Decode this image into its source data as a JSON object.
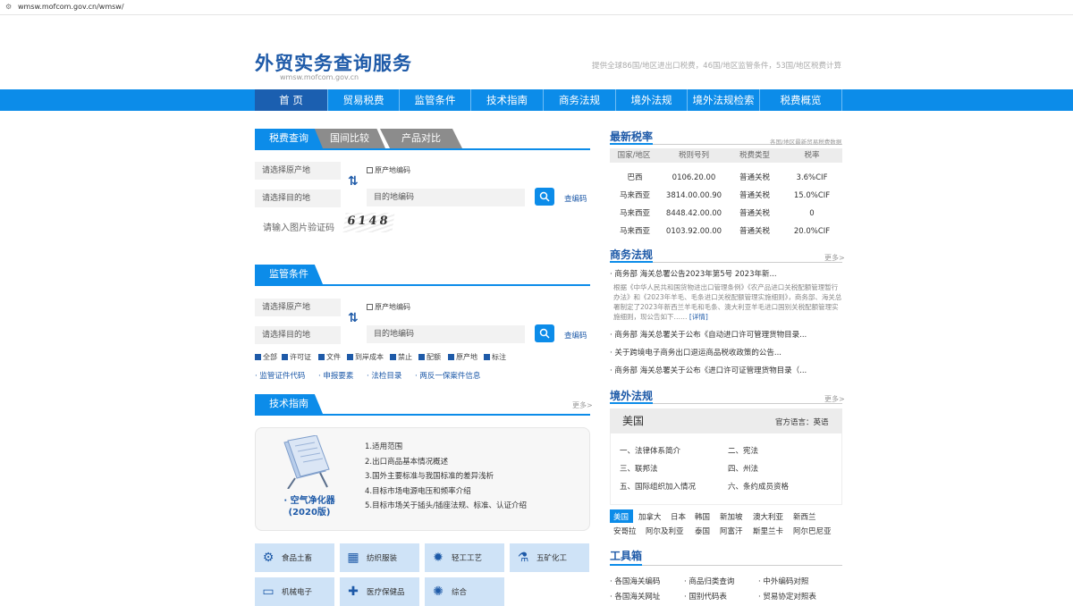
{
  "browser": {
    "url": "wmsw.mofcom.gov.cn/wmsw/"
  },
  "header": {
    "title": "外贸实务查询服务",
    "subtitle": "wmsw.mofcom.gov.cn",
    "slogan": "提供全球86国/地区进出口税费，46国/地区监管条件，53国/地区税费计算"
  },
  "nav": [
    "首 页",
    "贸易税费",
    "监管条件",
    "技术指南",
    "商务法规",
    "境外法规",
    "境外法规检索",
    "税费概览"
  ],
  "tax_query": {
    "tabs": [
      "税费查询",
      "国间比较",
      "产品对比"
    ],
    "origin_select": "请选择原产地",
    "origin_code_label": "原产地编码",
    "dest_select": "请选择目的地",
    "dest_code_placeholder": "目的地编码",
    "lookup_link": "查编码",
    "captcha_placeholder": "请输入图片验证码",
    "captcha_text": "6148"
  },
  "regulatory": {
    "title": "监管条件",
    "origin_select": "请选择原产地",
    "origin_code_label": "原产地编码",
    "dest_select": "请选择目的地",
    "dest_code_placeholder": "目的地编码",
    "lookup_link": "查编码",
    "checkboxes": [
      "全部",
      "许可证",
      "文件",
      "到岸成本",
      "禁止",
      "配额",
      "原产地",
      "标注"
    ],
    "links": [
      "监管证件代码",
      "申报要素",
      "法检目录",
      "两反一保案件信息"
    ]
  },
  "tech_guide": {
    "title": "技术指南",
    "more": "更多>",
    "book_title": "空气净化器",
    "book_edition": "(2020版)",
    "items": [
      "1.适用范围",
      "2.出口商品基本情况概述",
      "3.国外主要标准与我国标准的差异浅析",
      "4.目标市场电源电压和频率介绍",
      "5.目标市场关于插头/插座法规、标准、认证介绍"
    ]
  },
  "categories": [
    {
      "label": "食品土畜",
      "icon": "food-icon"
    },
    {
      "label": "纺织服装",
      "icon": "textile-icon"
    },
    {
      "label": "轻工工艺",
      "icon": "lightbulb-icon"
    },
    {
      "label": "五矿化工",
      "icon": "flask-icon"
    },
    {
      "label": "机械电子",
      "icon": "monitor-icon"
    },
    {
      "label": "医疗保健品",
      "icon": "medical-kit-icon"
    },
    {
      "label": "综合",
      "icon": "network-icon"
    }
  ],
  "latest_rates": {
    "title": "最新税率",
    "note": "各国/地区最新贸易税费数据",
    "headers": [
      "国家/地区",
      "税则号列",
      "税费类型",
      "税率"
    ],
    "rows": [
      [
        "巴西",
        "0106.20.00",
        "普通关税",
        "3.6%CIF"
      ],
      [
        "马来西亚",
        "3814.00.00.90",
        "普通关税",
        "15.0%CIF"
      ],
      [
        "马来西亚",
        "8448.42.00.00",
        "普通关税",
        "0"
      ],
      [
        "马来西亚",
        "0103.92.00.00",
        "普通关税",
        "20.0%CIF"
      ]
    ]
  },
  "commerce_laws": {
    "title": "商务法规",
    "more": "更多>",
    "featured": "商务部 海关总署公告2023年第5号 2023年新...",
    "featured_desc": "根据《中华人民共和国货物进出口管理条例》《农产品进口关税配额管理暂行办法》和《2023年羊毛、毛条进口关税配额管理实施细则》，商务部、海关总署制定了2023年新西兰羊毛和毛条、澳大利亚羊毛进口国别关税配额管理实施细则，现公告如下……",
    "detail_link": "[详情]",
    "items": [
      "商务部 海关总署关于公布《自动进口许可管理货物目录...",
      "关于跨境电子商务出口退运商品税收政策的公告...",
      "商务部 海关总署关于公布《进口许可证管理货物目录（..."
    ]
  },
  "overseas_laws": {
    "title": "境外法规",
    "more": "更多>",
    "country": "美国",
    "official_language": "官方语言：英语",
    "items": [
      "一、法律体系简介",
      "二、宪法",
      "三、联邦法",
      "四、州法",
      "五、国际组织加入情况",
      "六、条约成员资格"
    ],
    "countries_row1": [
      "美国",
      "加拿大",
      "日本",
      "韩国",
      "新加坡",
      "澳大利亚",
      "新西兰"
    ],
    "countries_row2": [
      "安哥拉",
      "阿尔及利亚",
      "泰国",
      "阿富汗",
      "斯里兰卡",
      "阿尔巴尼亚"
    ]
  },
  "toolbox": {
    "title": "工具箱",
    "items": [
      "各国海关编码",
      "商品归类查询",
      "中外编码对照",
      "各国海关网址",
      "国别代码表",
      "贸易协定对照表"
    ]
  }
}
